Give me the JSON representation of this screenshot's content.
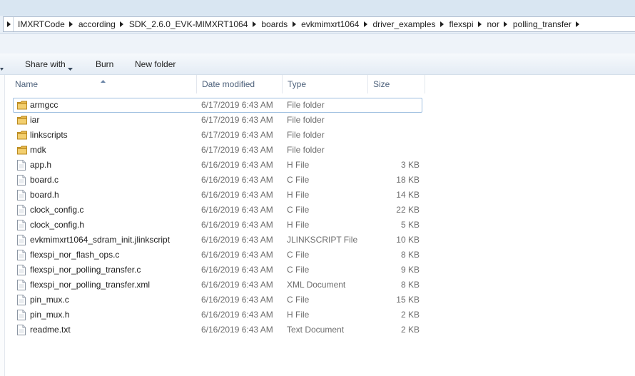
{
  "address": {
    "crumbs": [
      "IMXRTCode",
      "according",
      "SDK_2.6.0_EVK-MIMXRT1064",
      "boards",
      "evkmimxrt1064",
      "driver_examples",
      "flexspi",
      "nor",
      "polling_transfer"
    ]
  },
  "toolbar": {
    "share_label": "Share with",
    "burn_label": "Burn",
    "newfolder_label": "New folder"
  },
  "columns": {
    "name": "Name",
    "date": "Date modified",
    "type": "Type",
    "size": "Size"
  },
  "files": [
    {
      "name": "armgcc",
      "date": "6/17/2019 6:43 AM",
      "type": "File folder",
      "size": "",
      "icon": "folder-icon",
      "selected": true
    },
    {
      "name": "iar",
      "date": "6/17/2019 6:43 AM",
      "type": "File folder",
      "size": "",
      "icon": "folder-icon"
    },
    {
      "name": "linkscripts",
      "date": "6/17/2019 6:43 AM",
      "type": "File folder",
      "size": "",
      "icon": "folder-icon"
    },
    {
      "name": "mdk",
      "date": "6/17/2019 6:43 AM",
      "type": "File folder",
      "size": "",
      "icon": "folder-icon"
    },
    {
      "name": "app.h",
      "date": "6/16/2019 6:43 AM",
      "type": "H File",
      "size": "3 KB",
      "icon": "file-icon"
    },
    {
      "name": "board.c",
      "date": "6/16/2019 6:43 AM",
      "type": "C File",
      "size": "18 KB",
      "icon": "file-icon"
    },
    {
      "name": "board.h",
      "date": "6/16/2019 6:43 AM",
      "type": "H File",
      "size": "14 KB",
      "icon": "file-icon"
    },
    {
      "name": "clock_config.c",
      "date": "6/16/2019 6:43 AM",
      "type": "C File",
      "size": "22 KB",
      "icon": "file-icon"
    },
    {
      "name": "clock_config.h",
      "date": "6/16/2019 6:43 AM",
      "type": "H File",
      "size": "5 KB",
      "icon": "file-icon"
    },
    {
      "name": "evkmimxrt1064_sdram_init.jlinkscript",
      "date": "6/16/2019 6:43 AM",
      "type": "JLINKSCRIPT File",
      "size": "10 KB",
      "icon": "file-icon"
    },
    {
      "name": "flexspi_nor_flash_ops.c",
      "date": "6/16/2019 6:43 AM",
      "type": "C File",
      "size": "8 KB",
      "icon": "file-icon"
    },
    {
      "name": "flexspi_nor_polling_transfer.c",
      "date": "6/16/2019 6:43 AM",
      "type": "C File",
      "size": "9 KB",
      "icon": "file-icon"
    },
    {
      "name": "flexspi_nor_polling_transfer.xml",
      "date": "6/16/2019 6:43 AM",
      "type": "XML Document",
      "size": "8 KB",
      "icon": "file-icon"
    },
    {
      "name": "pin_mux.c",
      "date": "6/16/2019 6:43 AM",
      "type": "C File",
      "size": "15 KB",
      "icon": "file-icon"
    },
    {
      "name": "pin_mux.h",
      "date": "6/16/2019 6:43 AM",
      "type": "H File",
      "size": "2 KB",
      "icon": "file-icon"
    },
    {
      "name": "readme.txt",
      "date": "6/16/2019 6:43 AM",
      "type": "Text Document",
      "size": "2 KB",
      "icon": "file-icon"
    }
  ]
}
